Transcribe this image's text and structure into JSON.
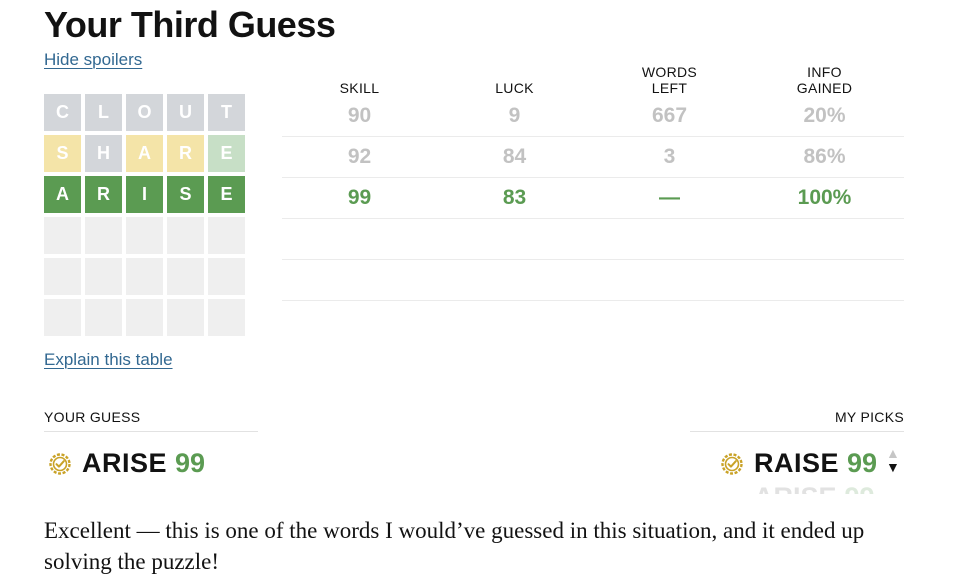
{
  "title": "Your Third Guess",
  "hide_spoilers": "Hide spoilers",
  "explain_table": "Explain this table",
  "grid": [
    {
      "letters": [
        "C",
        "L",
        "O",
        "U",
        "T"
      ],
      "colors": [
        "gray",
        "gray",
        "gray",
        "gray",
        "gray"
      ]
    },
    {
      "letters": [
        "S",
        "H",
        "A",
        "R",
        "E"
      ],
      "colors": [
        "yellow",
        "gray",
        "yellow",
        "yellow",
        "lightgreen"
      ]
    },
    {
      "letters": [
        "A",
        "R",
        "I",
        "S",
        "E"
      ],
      "colors": [
        "green",
        "green",
        "green",
        "green",
        "green"
      ]
    },
    {
      "letters": [
        "",
        "",
        "",
        "",
        ""
      ],
      "colors": [
        "empty",
        "empty",
        "empty",
        "empty",
        "empty"
      ]
    },
    {
      "letters": [
        "",
        "",
        "",
        "",
        ""
      ],
      "colors": [
        "empty",
        "empty",
        "empty",
        "empty",
        "empty"
      ]
    },
    {
      "letters": [
        "",
        "",
        "",
        "",
        ""
      ],
      "colors": [
        "empty",
        "empty",
        "empty",
        "empty",
        "empty"
      ]
    }
  ],
  "stats": {
    "headers": {
      "skill": "SKILL",
      "luck": "LUCK",
      "words_left_1": "WORDS",
      "words_left_2": "LEFT",
      "info_1": "INFO",
      "info_2": "GAINED"
    },
    "rows": [
      {
        "skill": "90",
        "luck": "9",
        "words_left": "667",
        "info": "20%"
      },
      {
        "skill": "92",
        "luck": "84",
        "words_left": "3",
        "info": "86%"
      },
      {
        "skill": "99",
        "luck": "83",
        "words_left": "—",
        "info": "100%"
      }
    ]
  },
  "your_guess": {
    "label": "YOUR GUESS",
    "word": "ARISE",
    "score": "99"
  },
  "my_picks": {
    "label": "MY PICKS",
    "word": "RAISE",
    "score": "99",
    "next_word": "ARISE",
    "next_score": "99"
  },
  "summary": "Excellent — this is one of the words I would’ve guessed in this situation, and it ended up solving the puzzle!",
  "colors": {
    "green": "#5b9b52",
    "yellow": "#f4e4a8",
    "gray": "#d3d6da",
    "link": "#326891",
    "badge": "#c9a227"
  }
}
